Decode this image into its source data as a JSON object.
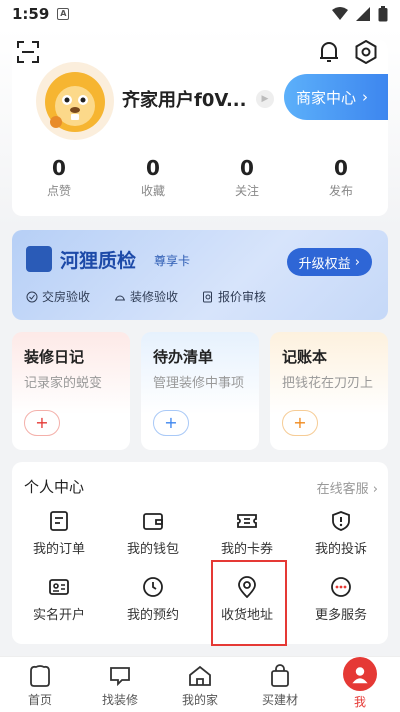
{
  "status_bar": {
    "time": "1:59",
    "notif_letter": "A"
  },
  "profile": {
    "username": "齐家用户f0V...",
    "merchant_center": "商家中心",
    "stats": [
      {
        "value": "0",
        "label": "点赞"
      },
      {
        "value": "0",
        "label": "收藏"
      },
      {
        "value": "0",
        "label": "关注"
      },
      {
        "value": "0",
        "label": "发布"
      }
    ]
  },
  "banner": {
    "title": "河狸质检",
    "subtitle": "尊享卡",
    "upgrade_label": "升级权益",
    "features": [
      "交房验收",
      "装修验收",
      "报价审核"
    ]
  },
  "tools": [
    {
      "title": "装修日记",
      "subtitle": "记录家的蜕变",
      "accent": "#e53935"
    },
    {
      "title": "待办清单",
      "subtitle": "管理装修中事项",
      "accent": "#3d86ef"
    },
    {
      "title": "记账本",
      "subtitle": "把钱花在刀刃上",
      "accent": "#f08a1d"
    }
  ],
  "personal_center": {
    "title": "个人中心",
    "online_service": "在线客服",
    "items": [
      {
        "label": "我的订单",
        "icon": "order-icon"
      },
      {
        "label": "我的钱包",
        "icon": "wallet-icon"
      },
      {
        "label": "我的卡券",
        "icon": "coupon-icon"
      },
      {
        "label": "我的投诉",
        "icon": "complaint-icon"
      },
      {
        "label": "实名开户",
        "icon": "id-card-icon"
      },
      {
        "label": "我的预约",
        "icon": "clock-icon"
      },
      {
        "label": "收货地址",
        "icon": "location-icon"
      },
      {
        "label": "更多服务",
        "icon": "more-icon"
      }
    ]
  },
  "tabbar": {
    "items": [
      {
        "label": "首页",
        "icon": "home-beaver-icon"
      },
      {
        "label": "找装修",
        "icon": "chat-bubble-icon"
      },
      {
        "label": "我的家",
        "icon": "house-icon"
      },
      {
        "label": "买建材",
        "icon": "shopping-bag-icon"
      },
      {
        "label": "我",
        "icon": "user-icon",
        "active": true
      }
    ]
  },
  "colors": {
    "accent_red": "#e53935",
    "accent_blue": "#3d86ef"
  }
}
